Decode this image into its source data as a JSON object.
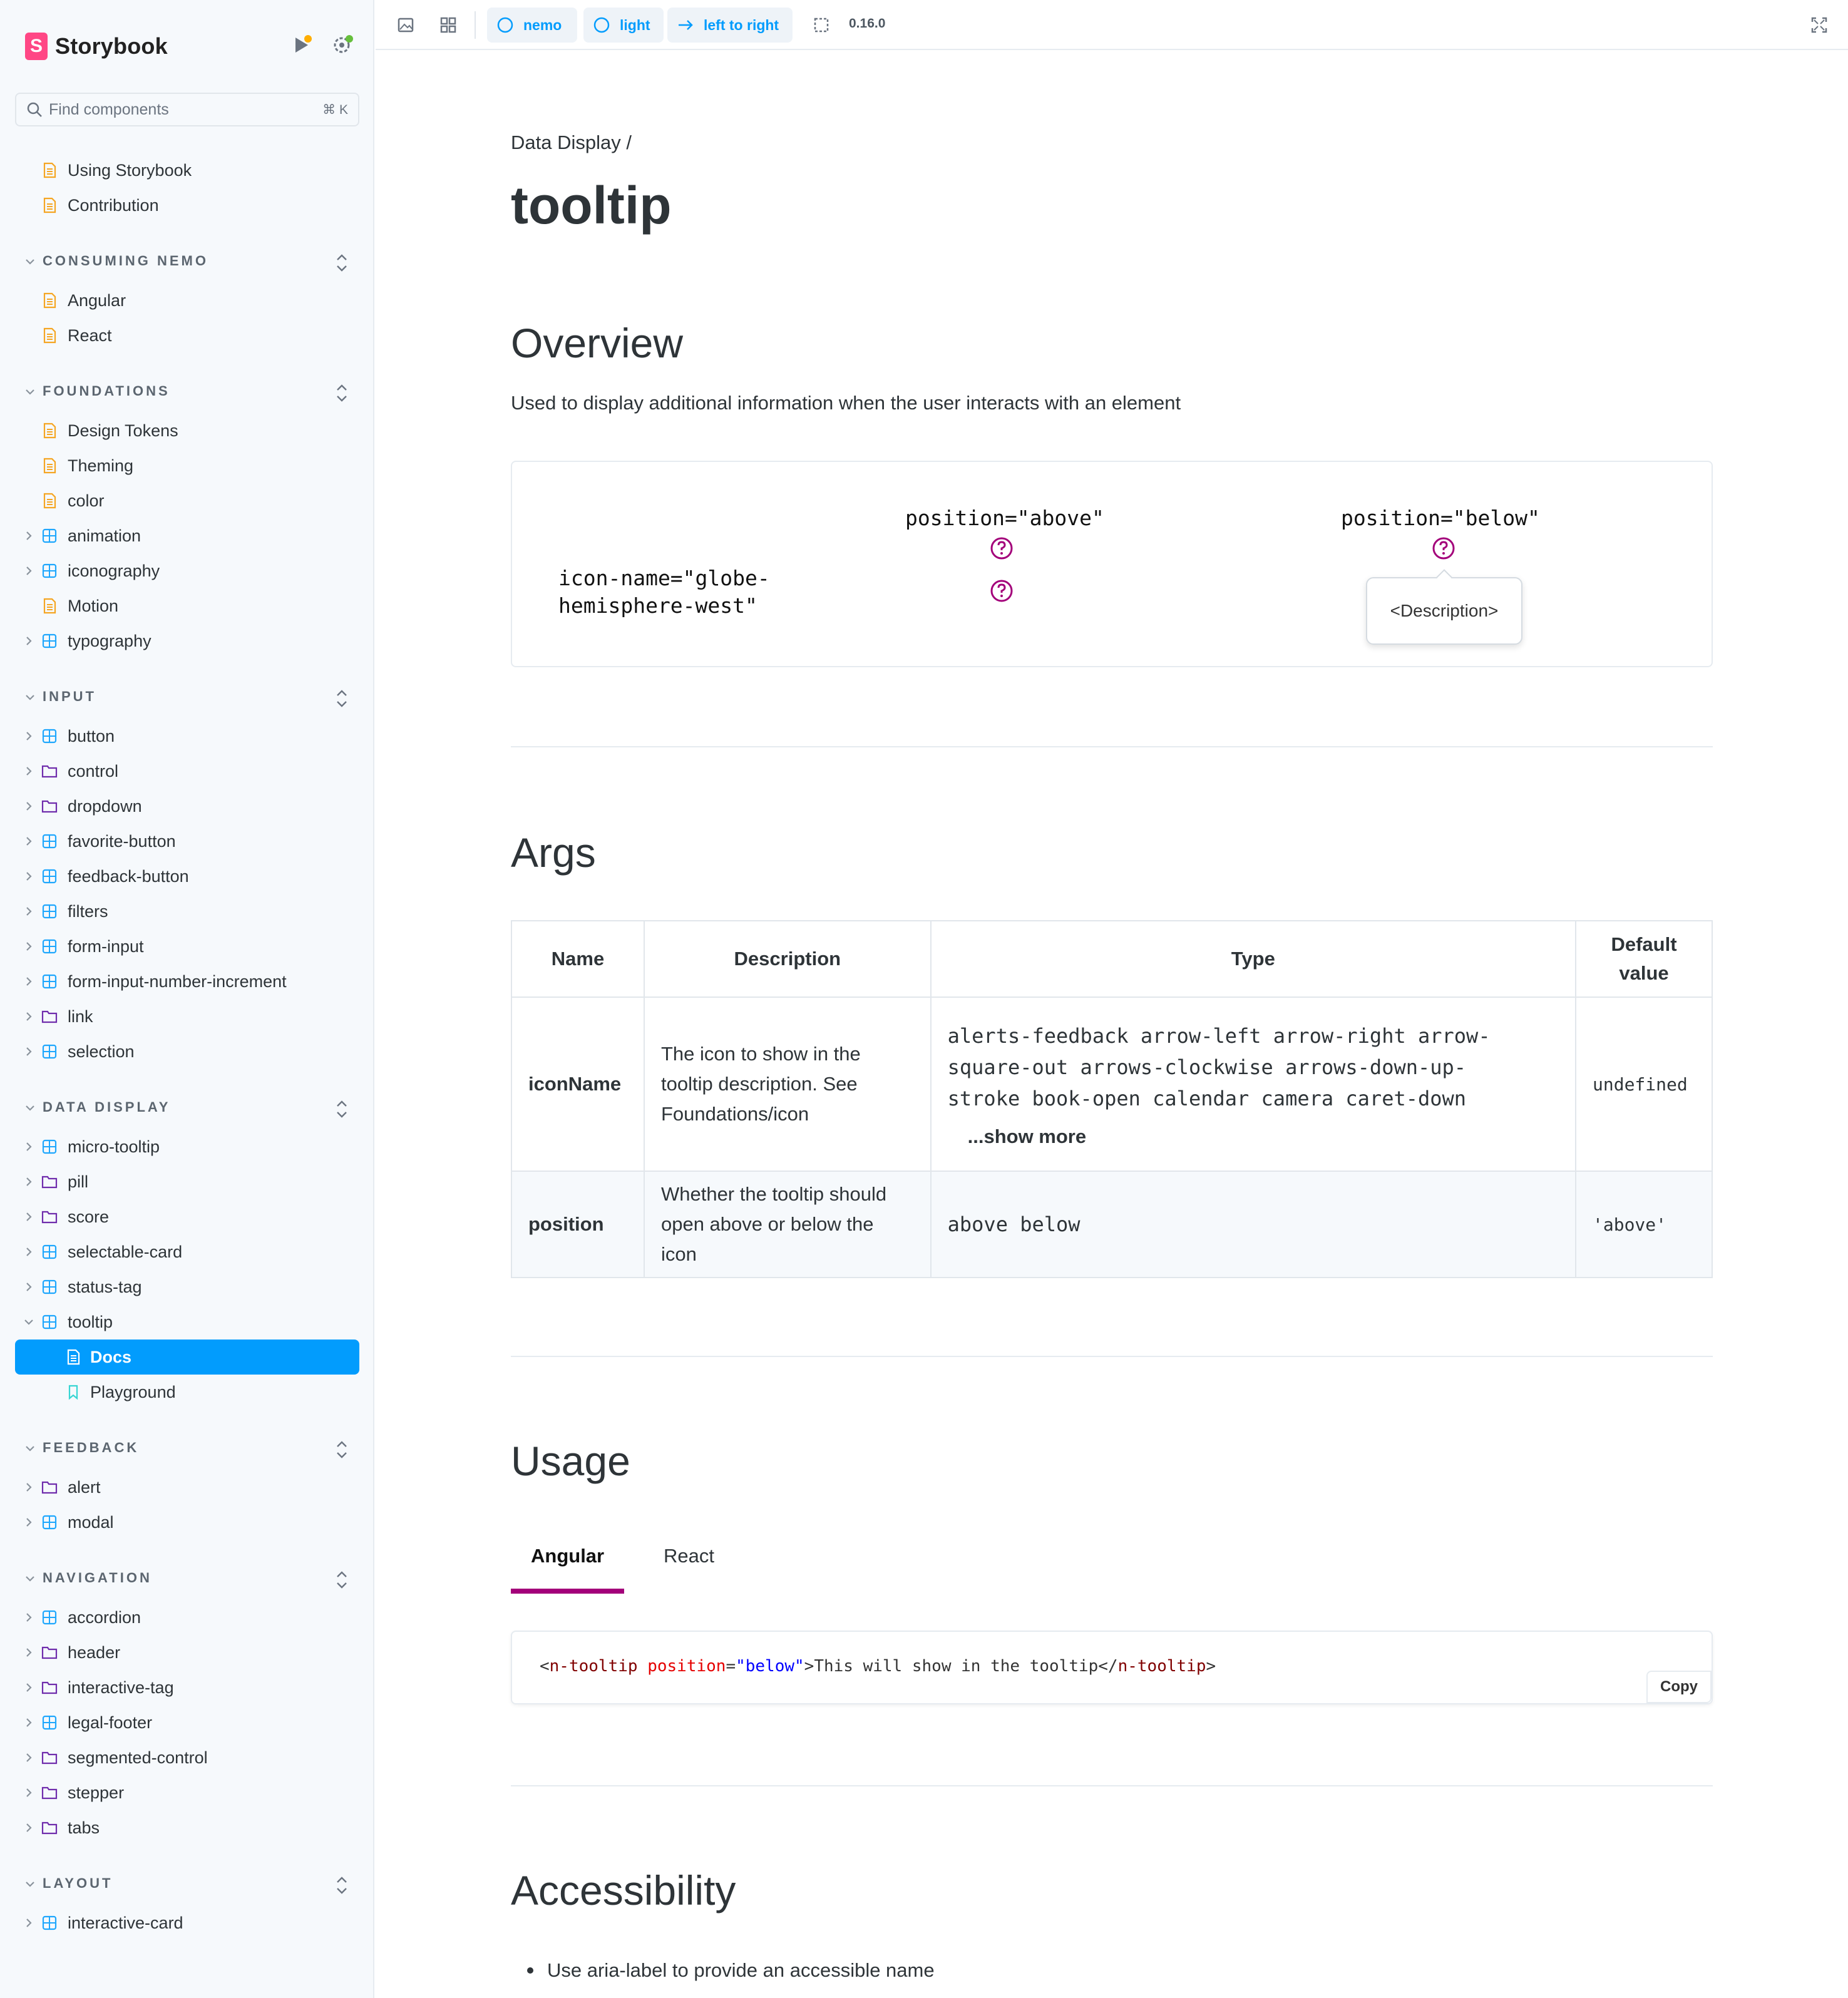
{
  "brand": {
    "name": "Storybook",
    "logo_letter": "S"
  },
  "sidebar": {
    "search_placeholder": "Find components",
    "search_shortcut": "⌘ K",
    "top_docs": [
      {
        "label": "Using Storybook",
        "icon": "doc-icon"
      },
      {
        "label": "Contribution",
        "icon": "doc-icon"
      }
    ],
    "sections": [
      {
        "title": "CONSUMING NEMO",
        "items": [
          {
            "label": "Angular",
            "icon": "doc-icon"
          },
          {
            "label": "React",
            "icon": "doc-icon"
          }
        ]
      },
      {
        "title": "FOUNDATIONS",
        "items": [
          {
            "label": "Design Tokens",
            "icon": "doc-icon"
          },
          {
            "label": "Theming",
            "icon": "doc-icon"
          },
          {
            "label": "color",
            "icon": "doc-icon"
          },
          {
            "label": "animation",
            "icon": "component-icon",
            "chevron": true
          },
          {
            "label": "iconography",
            "icon": "component-icon",
            "chevron": true
          },
          {
            "label": "Motion",
            "icon": "doc-icon"
          },
          {
            "label": "typography",
            "icon": "component-icon",
            "chevron": true
          }
        ]
      },
      {
        "title": "INPUT",
        "items": [
          {
            "label": "button",
            "icon": "component-icon",
            "chevron": true
          },
          {
            "label": "control",
            "icon": "folder-icon",
            "chevron": true
          },
          {
            "label": "dropdown",
            "icon": "folder-icon",
            "chevron": true
          },
          {
            "label": "favorite-button",
            "icon": "component-icon",
            "chevron": true
          },
          {
            "label": "feedback-button",
            "icon": "component-icon",
            "chevron": true
          },
          {
            "label": "filters",
            "icon": "component-icon",
            "chevron": true
          },
          {
            "label": "form-input",
            "icon": "component-icon",
            "chevron": true
          },
          {
            "label": "form-input-number-increment",
            "icon": "component-icon",
            "chevron": true
          },
          {
            "label": "link",
            "icon": "folder-icon",
            "chevron": true
          },
          {
            "label": "selection",
            "icon": "component-icon",
            "chevron": true
          }
        ]
      },
      {
        "title": "DATA DISPLAY",
        "items": [
          {
            "label": "micro-tooltip",
            "icon": "component-icon",
            "chevron": true
          },
          {
            "label": "pill",
            "icon": "folder-icon",
            "chevron": true
          },
          {
            "label": "score",
            "icon": "folder-icon",
            "chevron": true
          },
          {
            "label": "selectable-card",
            "icon": "component-icon",
            "chevron": true
          },
          {
            "label": "status-tag",
            "icon": "component-icon",
            "chevron": true
          },
          {
            "label": "tooltip",
            "icon": "component-icon",
            "chevron": true,
            "expanded": true
          },
          {
            "label": "Docs",
            "icon": "doc-icon",
            "child": true,
            "active": true
          },
          {
            "label": "Playground",
            "icon": "story-icon",
            "child": true
          }
        ]
      },
      {
        "title": "FEEDBACK",
        "items": [
          {
            "label": "alert",
            "icon": "folder-icon",
            "chevron": true
          },
          {
            "label": "modal",
            "icon": "component-icon",
            "chevron": true
          }
        ]
      },
      {
        "title": "NAVIGATION",
        "items": [
          {
            "label": "accordion",
            "icon": "component-icon",
            "chevron": true
          },
          {
            "label": "header",
            "icon": "folder-icon",
            "chevron": true
          },
          {
            "label": "interactive-tag",
            "icon": "folder-icon",
            "chevron": true
          },
          {
            "label": "legal-footer",
            "icon": "component-icon",
            "chevron": true
          },
          {
            "label": "segmented-control",
            "icon": "folder-icon",
            "chevron": true
          },
          {
            "label": "stepper",
            "icon": "folder-icon",
            "chevron": true
          },
          {
            "label": "tabs",
            "icon": "folder-icon",
            "chevron": true
          }
        ]
      },
      {
        "title": "LAYOUT",
        "items": [
          {
            "label": "interactive-card",
            "icon": "component-icon",
            "chevron": true
          }
        ]
      }
    ]
  },
  "toolbar": {
    "theme_pill": "nemo",
    "mode_pill": "light",
    "direction_pill": "left to right",
    "version": "0.16.0"
  },
  "docs": {
    "breadcrumb": "Data Display /",
    "title": "tooltip",
    "overview": {
      "heading": "Overview",
      "description": "Used to display additional information when the user interacts with an element"
    },
    "preview": {
      "col_above": "position=\"above\"",
      "col_below": "position=\"below\"",
      "row_label_line1": "icon-name=\"globe-",
      "row_label_line2": "hemisphere-west\"",
      "tooltip_text": "<Description>"
    },
    "args": {
      "heading": "Args",
      "headers": {
        "name": "Name",
        "description": "Description",
        "type": "Type",
        "default_line1": "Default",
        "default_line2": "value"
      },
      "rows": [
        {
          "name": "iconName",
          "description": "The icon to show in the tooltip description. See Foundations/icon",
          "type_line1": "alerts-feedback arrow-left arrow-right arrow-",
          "type_line2": "square-out arrows-clockwise arrows-down-up-",
          "type_line3": "stroke book-open calendar camera caret-down",
          "show_more": "...show more",
          "default": "undefined"
        },
        {
          "name": "position",
          "description": "Whether the tooltip should open above or below the icon",
          "type": "above below",
          "default": "'above'"
        }
      ]
    },
    "usage": {
      "heading": "Usage",
      "tabs": [
        "Angular",
        "React"
      ],
      "code": {
        "open_lt": "<",
        "tag": "n-tooltip",
        "attr": " position",
        "eq": "=",
        "val": "\"below\"",
        "close_gt": ">",
        "text": "This will show in the tooltip",
        "end_open": "</",
        "end_tag": "n-tooltip",
        "end_gt": ">"
      },
      "copy_label": "Copy"
    },
    "accessibility": {
      "heading": "Accessibility",
      "bullets": [
        "Use aria-label to provide an accessible name"
      ]
    }
  },
  "colors": {
    "accent": "#029cfd",
    "brand": "#ff4785",
    "tooltip_icon": "#a3007a",
    "active_tab": "#a3007a",
    "doc_icon": "#f5a623",
    "component_icon": "#1ea7fd",
    "folder_icon": "#6f2cac"
  }
}
